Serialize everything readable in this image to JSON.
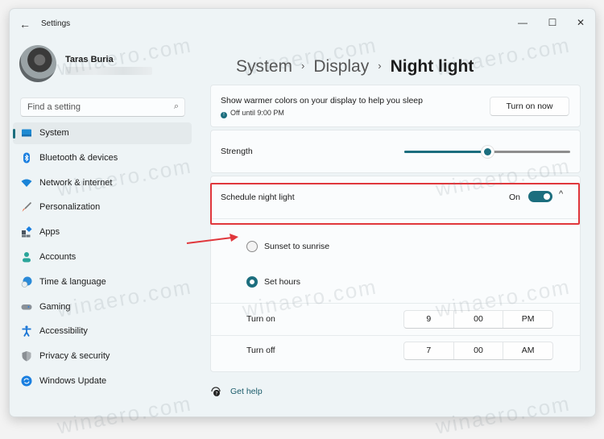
{
  "window": {
    "title": "Settings",
    "controls": {
      "minimize": "—",
      "maximize": "☐",
      "close": "✕"
    },
    "back_glyph": "←"
  },
  "profile": {
    "name": "Taras Buria"
  },
  "search": {
    "placeholder": "Find a setting",
    "icon": "search-icon",
    "glyph": "⌕"
  },
  "sidebar": {
    "items": [
      {
        "label": "System",
        "icon": "system-icon",
        "color": "#1f8ad2",
        "active": true
      },
      {
        "label": "Bluetooth & devices",
        "icon": "bluetooth-icon",
        "color": "#1a7fe0"
      },
      {
        "label": "Network & internet",
        "icon": "wifi-icon",
        "color": "#1a84d8"
      },
      {
        "label": "Personalization",
        "icon": "brush-icon",
        "color": "#e8643a"
      },
      {
        "label": "Apps",
        "icon": "apps-icon",
        "color": "#4a5560"
      },
      {
        "label": "Accounts",
        "icon": "accounts-icon",
        "color": "#2aa59a"
      },
      {
        "label": "Time & language",
        "icon": "time-language-icon",
        "color": "#2a8ad8"
      },
      {
        "label": "Gaming",
        "icon": "gaming-icon",
        "color": "#8a9198"
      },
      {
        "label": "Accessibility",
        "icon": "accessibility-icon",
        "color": "#1a76d6"
      },
      {
        "label": "Privacy & security",
        "icon": "shield-icon",
        "color": "#8a8f94"
      },
      {
        "label": "Windows Update",
        "icon": "windows-update-icon",
        "color": "#1a7fe0"
      }
    ]
  },
  "breadcrumb": {
    "items": [
      "System",
      "Display"
    ],
    "current": "Night light",
    "separator": "›"
  },
  "night_light": {
    "description": "Show warmer colors on your display to help you sleep",
    "status": "Off until 9:00 PM",
    "turn_on_button": "Turn on now",
    "strength_label": "Strength",
    "strength_value_percent": 50,
    "schedule_label": "Schedule night light",
    "schedule_state": "On",
    "schedule_enabled": true,
    "chevron": "^",
    "options": [
      {
        "label": "Sunset to sunrise",
        "selected": false
      },
      {
        "label": "Set hours",
        "selected": true
      }
    ],
    "turn_on": {
      "label": "Turn on",
      "hour": "9",
      "minute": "00",
      "period": "PM"
    },
    "turn_off": {
      "label": "Turn off",
      "hour": "7",
      "minute": "00",
      "period": "AM"
    }
  },
  "help": {
    "label": "Get help"
  },
  "watermark": "winaero.com",
  "colors": {
    "accent": "#1c6e7e",
    "highlight": "#e0373c"
  }
}
